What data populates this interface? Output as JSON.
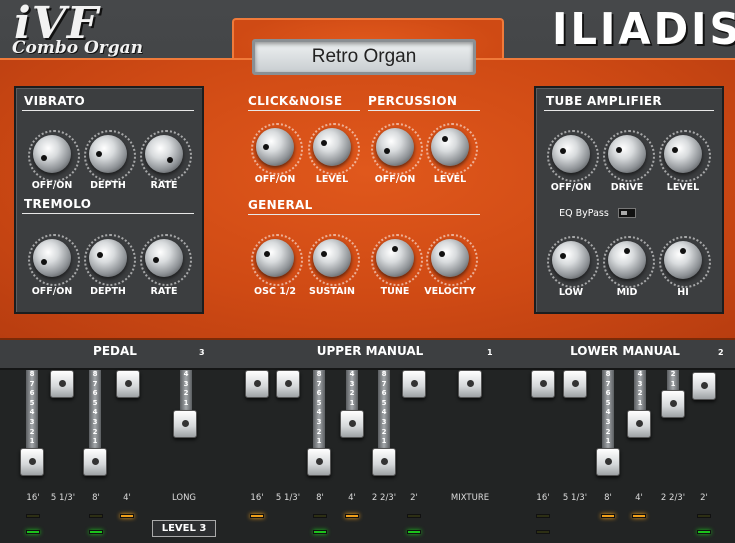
{
  "branding": {
    "logo": "iVF",
    "subtitle": "Combo Organ",
    "maker": "ILIADIS"
  },
  "display": {
    "preset": "Retro Organ"
  },
  "sections": {
    "vibrato": "VIBRATO",
    "tremolo": "TREMOLO",
    "click_noise": "CLICK&NOISE",
    "percussion": "PERCUSSION",
    "general": "GENERAL",
    "tube": "TUBE AMPLIFIER"
  },
  "knobs": {
    "vib_on": "OFF/ON",
    "vib_depth": "DEPTH",
    "vib_rate": "RATE",
    "trem_on": "OFF/ON",
    "trem_depth": "DEPTH",
    "trem_rate": "RATE",
    "click_on": "OFF/ON",
    "click_level": "LEVEL",
    "perc_on": "OFF/ON",
    "perc_level": "LEVEL",
    "osc": "OSC 1/2",
    "sustain": "SUSTAIN",
    "tune": "TUNE",
    "velocity": "VELOCITY",
    "tube_on": "OFF/ON",
    "drive": "DRIVE",
    "tube_level": "LEVEL",
    "low": "LOW",
    "mid": "MID",
    "hi": "HI"
  },
  "eq_bypass": "EQ ByPass",
  "manuals": {
    "pedal": {
      "label": "PEDAL",
      "channel": "3"
    },
    "upper": {
      "label": "UPPER MANUAL",
      "channel": "1"
    },
    "lower": {
      "label": "LOWER MANUAL",
      "channel": "2"
    }
  },
  "footers": {
    "p1": "16'",
    "p2": "5 1/3'",
    "p3": "8'",
    "p4": "4'",
    "p5": "LONG",
    "u1": "16'",
    "u2": "5 1/3'",
    "u3": "8'",
    "u4": "4'",
    "u5": "2 2/3'",
    "u6": "2'",
    "u7": "MIXTURE",
    "l1": "16'",
    "l2": "5 1/3'",
    "l3": "8'",
    "l4": "4'",
    "l5": "2 2/3'",
    "l6": "2'"
  },
  "scales": {
    "eight": "8 7 6 5 4 3 2 1",
    "four": "4 3 2 1",
    "two": "2 1"
  },
  "level_button": "LEVEL 3"
}
